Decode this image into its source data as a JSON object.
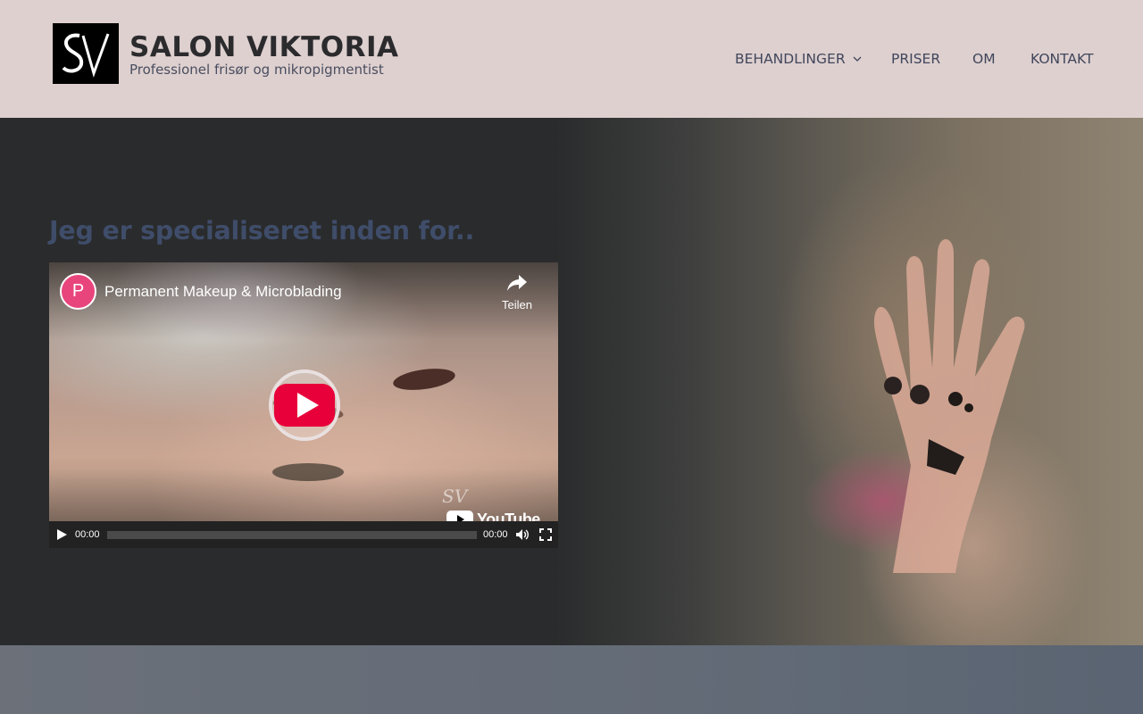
{
  "header": {
    "logo_alt": "SV",
    "site_title": "SALON VIKTORIA",
    "tagline": "Professionel frisør og mikropigmentist",
    "background": "#ded0cf"
  },
  "nav": {
    "items": [
      {
        "label": "BEHANDLINGER",
        "has_dropdown": true
      },
      {
        "label": "PRISER"
      },
      {
        "label": "OM"
      },
      {
        "label": "KONTAKT"
      }
    ]
  },
  "hero": {
    "heading": "Jeg er specialiseret inden for..",
    "heading_color": "#3f4d6a"
  },
  "video": {
    "channel_initial": "P",
    "channel_color": "#e8457c",
    "title": "Permanent Makeup & Microblading",
    "share_label": "Teilen",
    "watermark": "SV",
    "youtube_label": "YouTube",
    "time_current": "00:00",
    "time_total": "00:00",
    "progress": 0,
    "play_color": "#e8003a"
  }
}
